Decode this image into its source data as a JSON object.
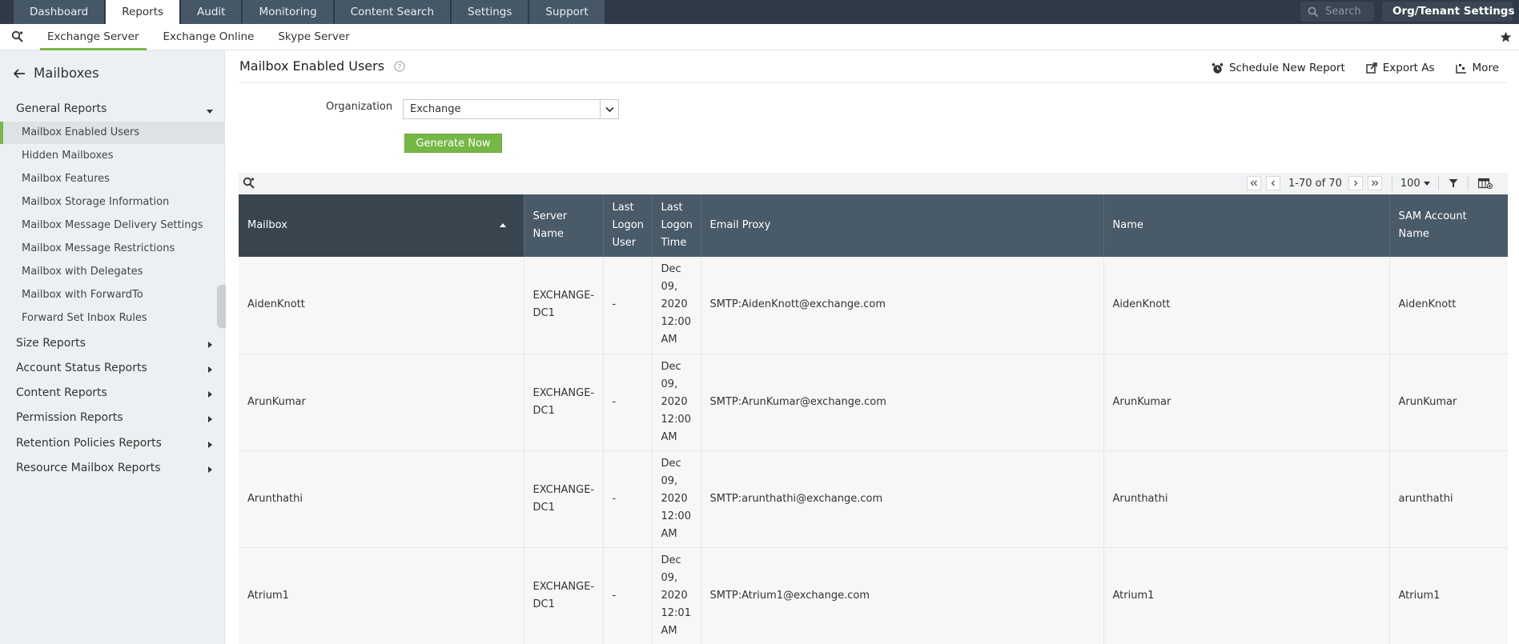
{
  "topnav": {
    "tabs": [
      "Dashboard",
      "Reports",
      "Audit",
      "Monitoring",
      "Content Search",
      "Settings",
      "Support"
    ],
    "active_tab": "Reports",
    "search_placeholder": "Search",
    "org_settings_label": "Org/Tenant Settings"
  },
  "subnav": {
    "tabs": [
      "Exchange Server",
      "Exchange Online",
      "Skype Server"
    ],
    "active_tab": "Exchange Server"
  },
  "sidebar": {
    "title": "Mailboxes",
    "groups": [
      {
        "label": "General Reports",
        "expanded": true,
        "items": [
          "Mailbox Enabled Users",
          "Hidden Mailboxes",
          "Mailbox Features",
          "Mailbox Storage Information",
          "Mailbox Message Delivery Settings",
          "Mailbox Message Restrictions",
          "Mailbox with Delegates",
          "Mailbox with ForwardTo",
          "Forward Set Inbox Rules"
        ],
        "active_item": "Mailbox Enabled Users"
      },
      {
        "label": "Size Reports",
        "expanded": false
      },
      {
        "label": "Account Status Reports",
        "expanded": false
      },
      {
        "label": "Content Reports",
        "expanded": false
      },
      {
        "label": "Permission Reports",
        "expanded": false
      },
      {
        "label": "Retention Policies Reports",
        "expanded": false
      },
      {
        "label": "Resource Mailbox Reports",
        "expanded": false
      }
    ]
  },
  "report": {
    "title": "Mailbox Enabled Users",
    "actions": {
      "schedule": "Schedule New Report",
      "export": "Export As",
      "more": "More"
    },
    "organization_label": "Organization",
    "organization_value": "Exchange",
    "generate_label": "Generate Now",
    "pager": {
      "range": "1-70 of 70",
      "per_page": "100"
    },
    "columns": [
      {
        "label": "Mailbox",
        "sorted": "asc"
      },
      {
        "label": "Server Name"
      },
      {
        "label": "Last Logon User"
      },
      {
        "label": "Last Logon Time"
      },
      {
        "label": "Email Proxy"
      },
      {
        "label": "Name"
      },
      {
        "label": "SAM Account Name"
      }
    ],
    "rows": [
      [
        "AidenKnott",
        "EXCHANGE-DC1",
        "-",
        "Dec 09, 2020 12:00 AM",
        "SMTP:AidenKnott@exchange.com",
        "AidenKnott",
        "AidenKnott"
      ],
      [
        "ArunKumar",
        "EXCHANGE-DC1",
        "-",
        "Dec 09, 2020 12:00 AM",
        "SMTP:ArunKumar@exchange.com",
        "ArunKumar",
        "ArunKumar"
      ],
      [
        "Arunthathi",
        "EXCHANGE-DC1",
        "-",
        "Dec 09, 2020 12:00 AM",
        "SMTP:arunthathi@exchange.com",
        "Arunthathi",
        "arunthathi"
      ],
      [
        "Atrium1",
        "EXCHANGE-DC1",
        "-",
        "Dec 09, 2020 12:01 AM",
        "SMTP:Atrium1@exchange.com",
        "Atrium1",
        "Atrium1"
      ]
    ]
  },
  "colors": {
    "topnav_bg": "#2e3a45",
    "tab_bg": "#465868",
    "accent_green": "#75b845",
    "table_header": "#495a68",
    "sidebar_bg": "#ecf0f2"
  }
}
